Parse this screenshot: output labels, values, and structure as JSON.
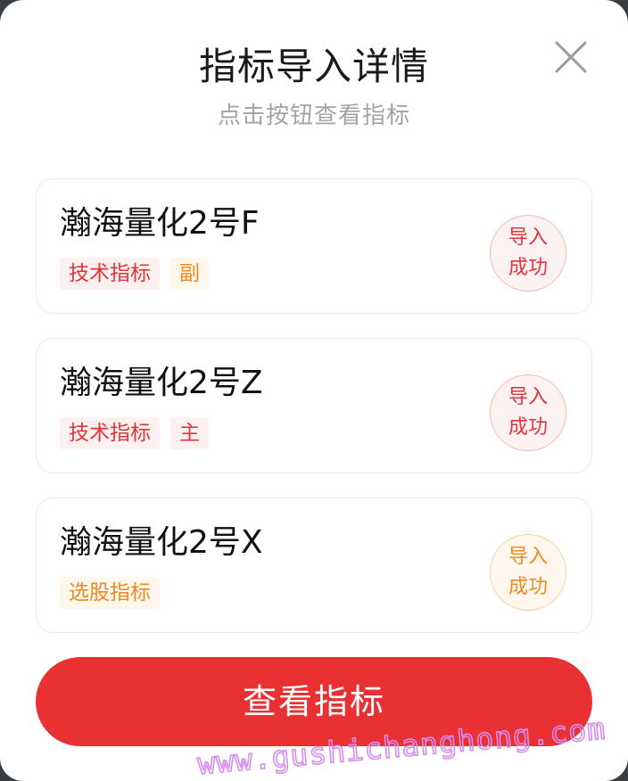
{
  "dialog": {
    "title": "指标导入详情",
    "subtitle": "点击按钮查看指标",
    "close_icon": "close-icon"
  },
  "items": [
    {
      "name": "瀚海量化2号F",
      "tags": [
        {
          "label": "技术指标",
          "color": "#e0353a"
        },
        {
          "label": "副",
          "color": "#f08a1f"
        }
      ],
      "status": {
        "line1": "导入",
        "line2": "成功",
        "color": "#e0353a"
      }
    },
    {
      "name": "瀚海量化2号Z",
      "tags": [
        {
          "label": "技术指标",
          "color": "#e0353a"
        },
        {
          "label": "主",
          "color": "#e0353a"
        }
      ],
      "status": {
        "line1": "导入",
        "line2": "成功",
        "color": "#e0353a"
      }
    },
    {
      "name": "瀚海量化2号X",
      "tags": [
        {
          "label": "选股指标",
          "color": "#f08a1f"
        }
      ],
      "status": {
        "line1": "导入",
        "line2": "成功",
        "color": "#f08a1f"
      }
    }
  ],
  "action": {
    "view_label": "查看指标",
    "color": "#e93134"
  },
  "watermark": {
    "text": "www.gushichanghong.com",
    "color": "#d78cf0"
  }
}
